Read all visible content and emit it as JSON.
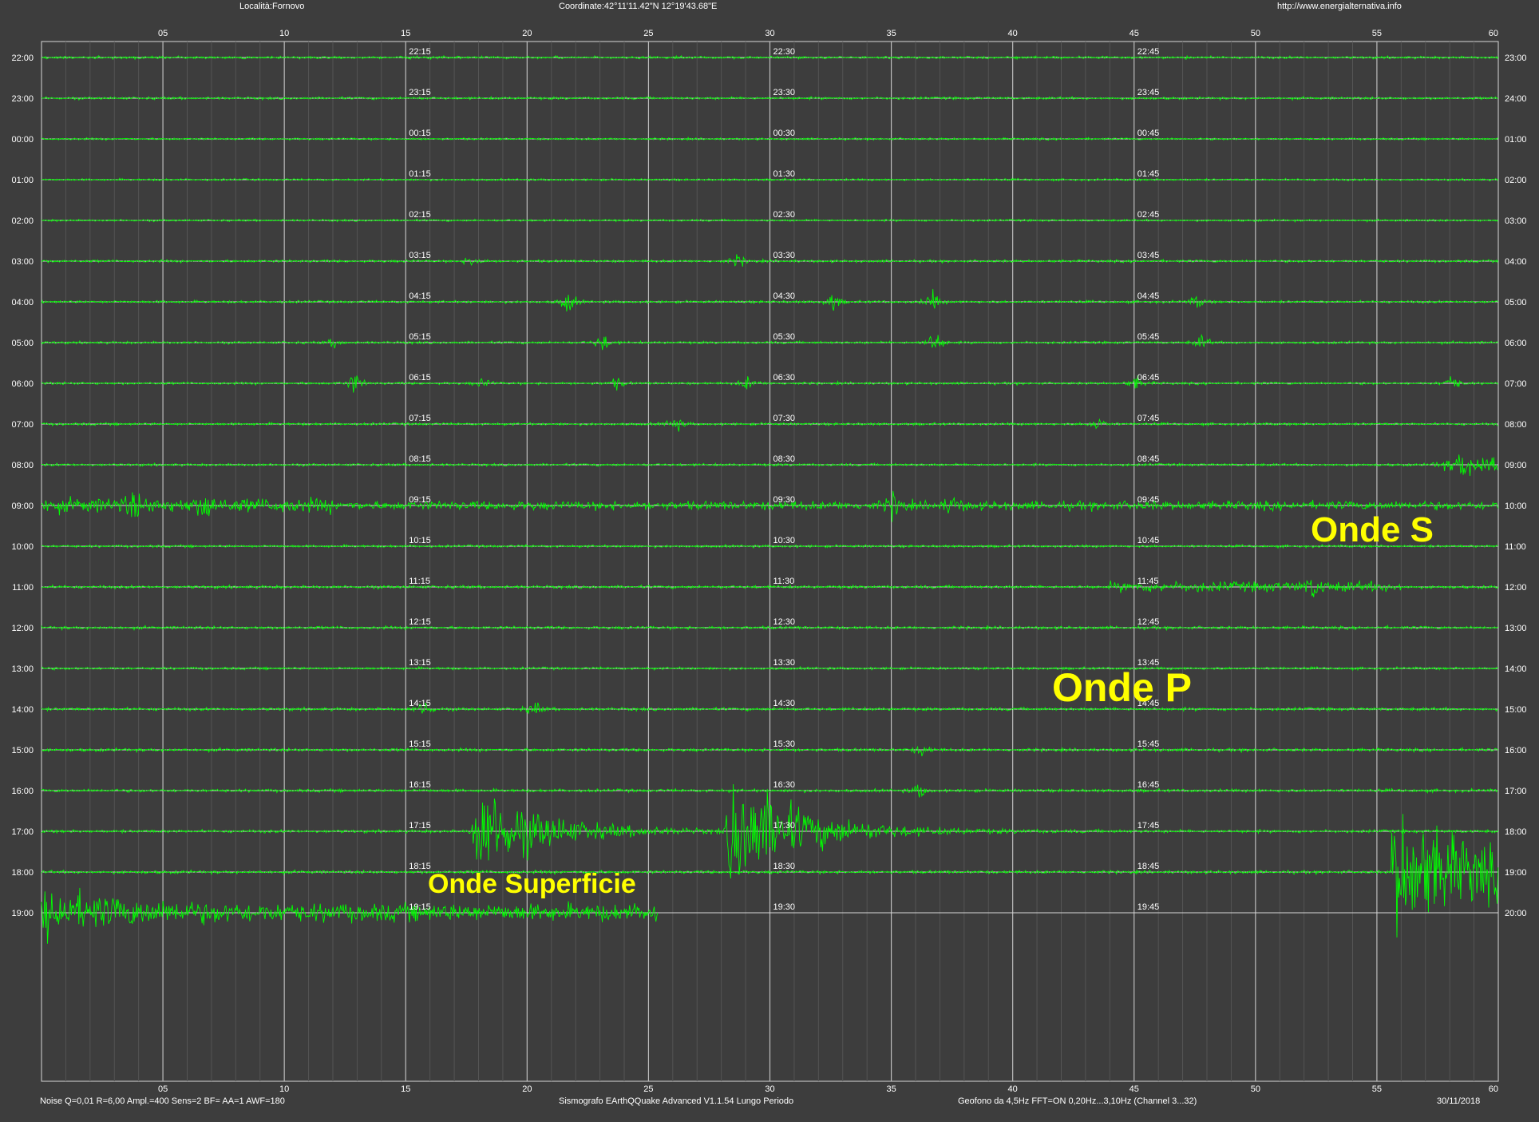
{
  "header": {
    "location": "Località:Fornovo",
    "coordinates": "Coordinate:42°11'11.42\"N  12°19'43.68\"E",
    "website": "http://www.energialternativa.info"
  },
  "footer": {
    "params": "Noise Q=0,01 R=6,00 Ampl.=400 Sens=2 BF= AA=1 AWF=180",
    "software": "Sismografo  EArthQQuake Advanced V1.1.54  Lungo Periodo",
    "geophone": "Geofono da 4,5Hz FFT=ON 0,20Hz...3,10Hz      (Channel 3...32)",
    "date": "30/11/2018"
  },
  "colors": {
    "background": "#3d3d3d",
    "trace": "#00ff00",
    "gridline": "#d8d8d8",
    "label_text": "#ffffff",
    "annotation": "#ffff00"
  },
  "chart_data": {
    "type": "line",
    "title": "",
    "xlabel": "",
    "ylabel": "",
    "x_unit": "minutes",
    "xlim": [
      0,
      60
    ],
    "x_ticks": [
      "05",
      "10",
      "15",
      "20",
      "25",
      "30",
      "35",
      "40",
      "45",
      "50",
      "55",
      "60"
    ],
    "grid": true,
    "hours_left": [
      "22:00",
      "23:00",
      "00:00",
      "01:00",
      "02:00",
      "03:00",
      "04:00",
      "05:00",
      "06:00",
      "07:00",
      "08:00",
      "09:00",
      "10:00",
      "11:00",
      "12:00",
      "13:00",
      "14:00",
      "15:00",
      "16:00",
      "17:00",
      "18:00",
      "19:00"
    ],
    "hours_right": [
      "23:00",
      "24:00",
      "01:00",
      "02:00",
      "03:00",
      "04:00",
      "05:00",
      "06:00",
      "07:00",
      "08:00",
      "09:00",
      "10:00",
      "11:00",
      "12:00",
      "13:00",
      "14:00",
      "15:00",
      "16:00",
      "17:00",
      "18:00",
      "19:00",
      "20:00"
    ],
    "quarter_marks": [
      [
        "22:15",
        "22:30",
        "22:45"
      ],
      [
        "23:15",
        "23:30",
        "23:45"
      ],
      [
        "00:15",
        "00:30",
        "00:45"
      ],
      [
        "01:15",
        "01:30",
        "01:45"
      ],
      [
        "02:15",
        "02:30",
        "02:45"
      ],
      [
        "03:15",
        "03:30",
        "03:45"
      ],
      [
        "04:15",
        "04:30",
        "04:45"
      ],
      [
        "05:15",
        "05:30",
        "05:45"
      ],
      [
        "06:15",
        "06:30",
        "06:45"
      ],
      [
        "07:15",
        "07:30",
        "07:45"
      ],
      [
        "08:15",
        "08:30",
        "08:45"
      ],
      [
        "09:15",
        "09:30",
        "09:45"
      ],
      [
        "10:15",
        "10:30",
        "10:45"
      ],
      [
        "11:15",
        "11:30",
        "11:45"
      ],
      [
        "12:15",
        "12:30",
        "12:45"
      ],
      [
        "13:15",
        "13:30",
        "13:45"
      ],
      [
        "14:15",
        "14:30",
        "14:45"
      ],
      [
        "15:15",
        "15:30",
        "15:45"
      ],
      [
        "16:15",
        "16:30",
        "16:45"
      ],
      [
        "17:15",
        "17:30",
        "17:45"
      ],
      [
        "18:15",
        "18:30",
        "18:45"
      ],
      [
        "19:15",
        "19:30",
        "19:45"
      ]
    ],
    "noise_level": [
      0.25,
      0.25,
      0.2,
      0.2,
      0.2,
      0.25,
      0.25,
      0.25,
      0.25,
      0.25,
      0.25,
      0.3,
      0.25,
      0.3,
      0.3,
      0.25,
      0.3,
      0.3,
      0.3,
      0.3,
      0.3,
      0.3
    ],
    "recording_end_minute": 25.4,
    "events": [
      {
        "row": 5,
        "minute": 17.8,
        "amp": 1.4
      },
      {
        "row": 5,
        "minute": 28.7,
        "amp": 1.2
      },
      {
        "row": 6,
        "minute": 21.7,
        "amp": 2.2
      },
      {
        "row": 6,
        "minute": 32.6,
        "amp": 1.6
      },
      {
        "row": 6,
        "minute": 36.7,
        "amp": 1.8
      },
      {
        "row": 6,
        "minute": 47.6,
        "amp": 1.1
      },
      {
        "row": 7,
        "minute": 12.1,
        "amp": 0.9
      },
      {
        "row": 7,
        "minute": 23.1,
        "amp": 1.8
      },
      {
        "row": 7,
        "minute": 36.8,
        "amp": 2.4
      },
      {
        "row": 7,
        "minute": 47.8,
        "amp": 1.3
      },
      {
        "row": 8,
        "minute": 12.9,
        "amp": 2.0
      },
      {
        "row": 8,
        "minute": 18.2,
        "amp": 1.0
      },
      {
        "row": 8,
        "minute": 23.7,
        "amp": 1.0
      },
      {
        "row": 8,
        "minute": 29.1,
        "amp": 1.3
      },
      {
        "row": 8,
        "minute": 45.1,
        "amp": 1.2
      },
      {
        "row": 8,
        "minute": 58.1,
        "amp": 1.6
      },
      {
        "row": 9,
        "minute": 26.1,
        "amp": 1.6
      },
      {
        "row": 9,
        "minute": 43.5,
        "amp": 1.3
      },
      {
        "row": 10,
        "minute": 58.5,
        "amp": 1.7
      },
      {
        "row": 11,
        "minute": 3.8,
        "amp": 2.0
      },
      {
        "row": 11,
        "minute": 6.8,
        "amp": 2.2
      },
      {
        "row": 11,
        "minute": 35.1,
        "amp": 2.0
      },
      {
        "row": 11,
        "minute": 37.5,
        "amp": 1.6
      },
      {
        "row": 13,
        "minute": 52.4,
        "amp": 1.7
      },
      {
        "row": 16,
        "minute": 15.8,
        "amp": 1.7
      },
      {
        "row": 16,
        "minute": 20.3,
        "amp": 1.4
      },
      {
        "row": 17,
        "minute": 36.3,
        "amp": 1.1
      },
      {
        "row": 18,
        "minute": 36.2,
        "amp": 1.3
      }
    ],
    "quakes": [
      {
        "name": "Onde P",
        "minute": 41.6,
        "row": 18.6,
        "amp": 9.0
      },
      {
        "name": "Onde S",
        "minute": 52.1,
        "row": 18.6,
        "amp": 12.0
      },
      {
        "name": "Onde Superficie",
        "minute": 1.6,
        "row": 20.9,
        "amp": 10.0
      }
    ],
    "annotations": [
      "Onde S",
      "Onde P",
      "Onde Superficie"
    ]
  }
}
